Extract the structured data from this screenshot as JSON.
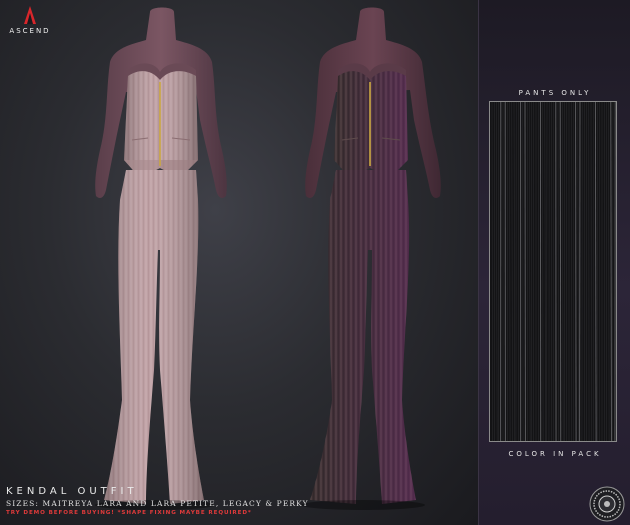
{
  "brand": {
    "name": "ASCEND",
    "accent_color": "#d8262b"
  },
  "product": {
    "title": "KENDAL OUTFIT",
    "sizes": "SIZES: MAITREYA LARA AND LARA PETITE, LEGACY & PERKY",
    "warning": "TRY DEMO BEFORE BUYING! *SHAPE FIXING MAYBE REQUIRED*"
  },
  "swatch_panel": {
    "top_label": "PANTS ONLY",
    "bottom_label": "COLOR IN PACK"
  },
  "figures": [
    {
      "name": "pink-outfit",
      "fabric_color": "#b8989c"
    },
    {
      "name": "brown-outfit",
      "fabric_color": "#3b3030"
    }
  ],
  "icons": {
    "logo": "triangle-logo-icon",
    "seal": "round-seal-icon"
  }
}
